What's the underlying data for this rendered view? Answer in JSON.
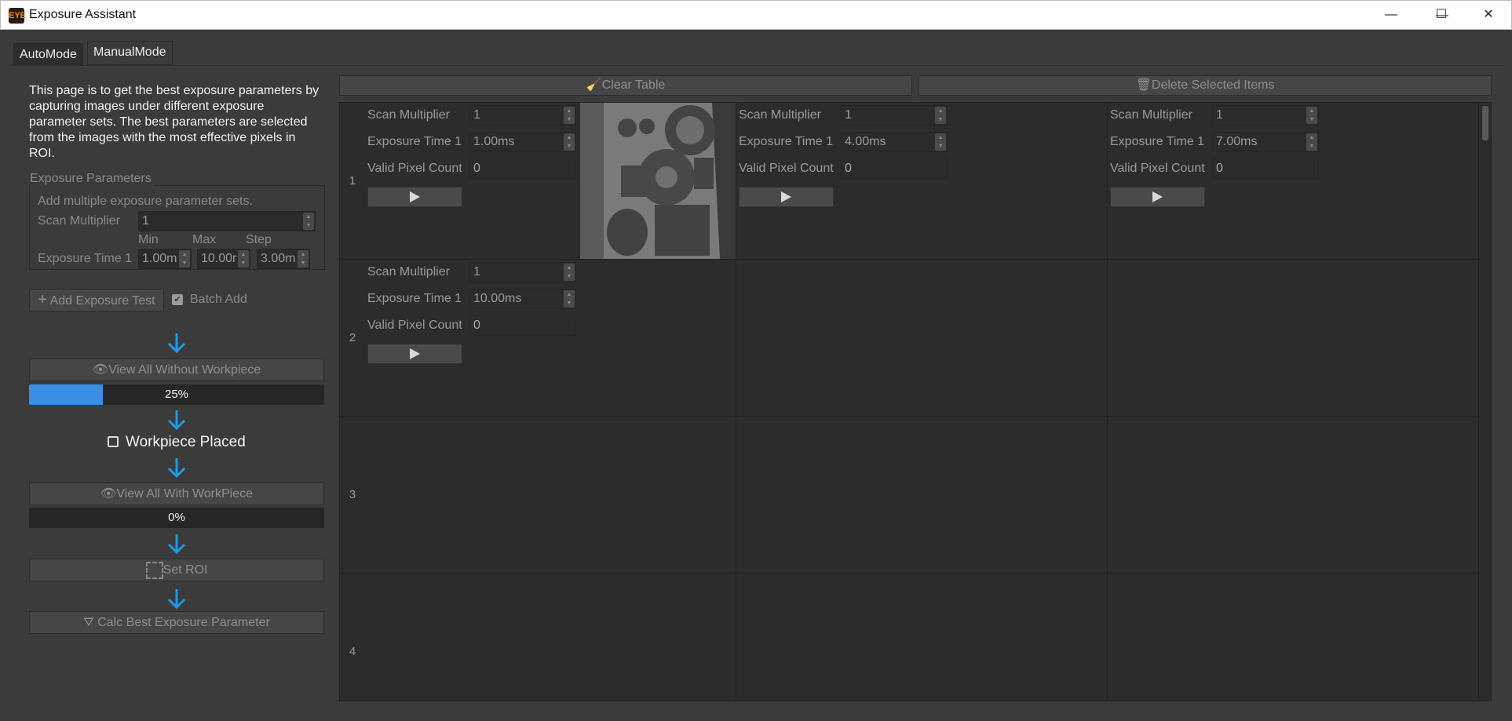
{
  "window": {
    "title": "Exposure Assistant",
    "logo": "EYE",
    "minimize": "—",
    "maximize": "☐",
    "close": "✕"
  },
  "tabs": [
    {
      "label": "AutoMode"
    },
    {
      "label": "ManualMode"
    }
  ],
  "left": {
    "description": "This page is to get the best exposure parameters by capturing images under different exposure parameter sets. The best parameters are selected from the images with the most effective pixels in ROI.",
    "group_title": "Exposure Parameters",
    "group_hint": "Add multiple exposure parameter sets.",
    "scan_multiplier_label": "Scan Multiplier",
    "scan_multiplier_value": "1",
    "min_label": "Min",
    "max_label": "Max",
    "step_label": "Step",
    "exposure_label": "Exposure Time 1",
    "min_value": "1.00m",
    "max_value": "10.00r",
    "step_value": "3.00m",
    "add_test": "Add Exposure Test",
    "batch_add": "Batch Add",
    "view_without": "View All Without Workpiece",
    "progress1": "25%",
    "progress1_value": 25,
    "workpiece_placed": "Workpiece Placed",
    "view_with": "View All With WorkPiece",
    "progress2": "0%",
    "progress2_value": 0,
    "set_roi": "Set ROI",
    "calc": "Calc Best Exposure Parameter",
    "accent": "#1e9be0"
  },
  "toolbar": {
    "clear": "Clear Table",
    "delete": "Delete Selected Items"
  },
  "table": {
    "row_headers": [
      "1",
      "2",
      "3",
      "4"
    ],
    "labels": {
      "scan": "Scan Multiplier",
      "exposure": "Exposure Time 1",
      "valid": "Valid Pixel Count"
    },
    "cells": [
      {
        "row": 0,
        "col": 0,
        "scan": "1",
        "exposure": "1.00ms",
        "valid": "0",
        "has_image": true
      },
      {
        "row": 0,
        "col": 1,
        "scan": "1",
        "exposure": "4.00ms",
        "valid": "0",
        "has_image": false
      },
      {
        "row": 0,
        "col": 2,
        "scan": "1",
        "exposure": "7.00ms",
        "valid": "0",
        "has_image": false
      },
      {
        "row": 1,
        "col": 0,
        "scan": "1",
        "exposure": "10.00ms",
        "valid": "0",
        "has_image": false
      }
    ]
  }
}
